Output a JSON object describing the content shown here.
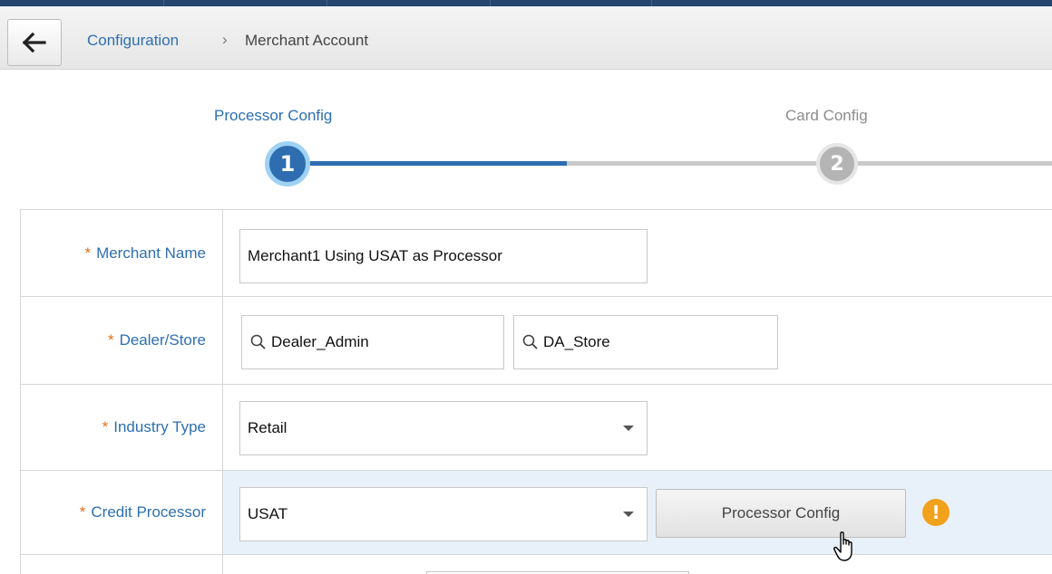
{
  "header": {
    "back_icon": "arrow-left-icon"
  },
  "breadcrumb": {
    "link": "Configuration",
    "separator": "›",
    "current": "Merchant Account"
  },
  "wizard": {
    "steps": [
      {
        "number": "1",
        "label": "Processor Config",
        "state": "active"
      },
      {
        "number": "2",
        "label": "Card Config",
        "state": "inactive"
      }
    ],
    "progress": 0.5
  },
  "form": {
    "required_marker": "*",
    "merchant_name": {
      "label": "Merchant Name",
      "value": "Merchant1 Using USAT as Processor"
    },
    "dealer_store": {
      "label": "Dealer/Store",
      "dealer_value": "Dealer_Admin",
      "store_value": "DA_Store",
      "icon": "search-icon"
    },
    "industry_type": {
      "label": "Industry Type",
      "value": "Retail"
    },
    "credit_processor": {
      "label": "Credit Processor",
      "value": "USAT",
      "button_label": "Processor Config",
      "warning_glyph": "!",
      "warning_icon": "warning-icon"
    }
  },
  "colors": {
    "link_blue": "#2d6fb1",
    "required_orange": "#e0701a",
    "warning_orange": "#f1a11c",
    "highlight_row": "#e8f1fa"
  }
}
